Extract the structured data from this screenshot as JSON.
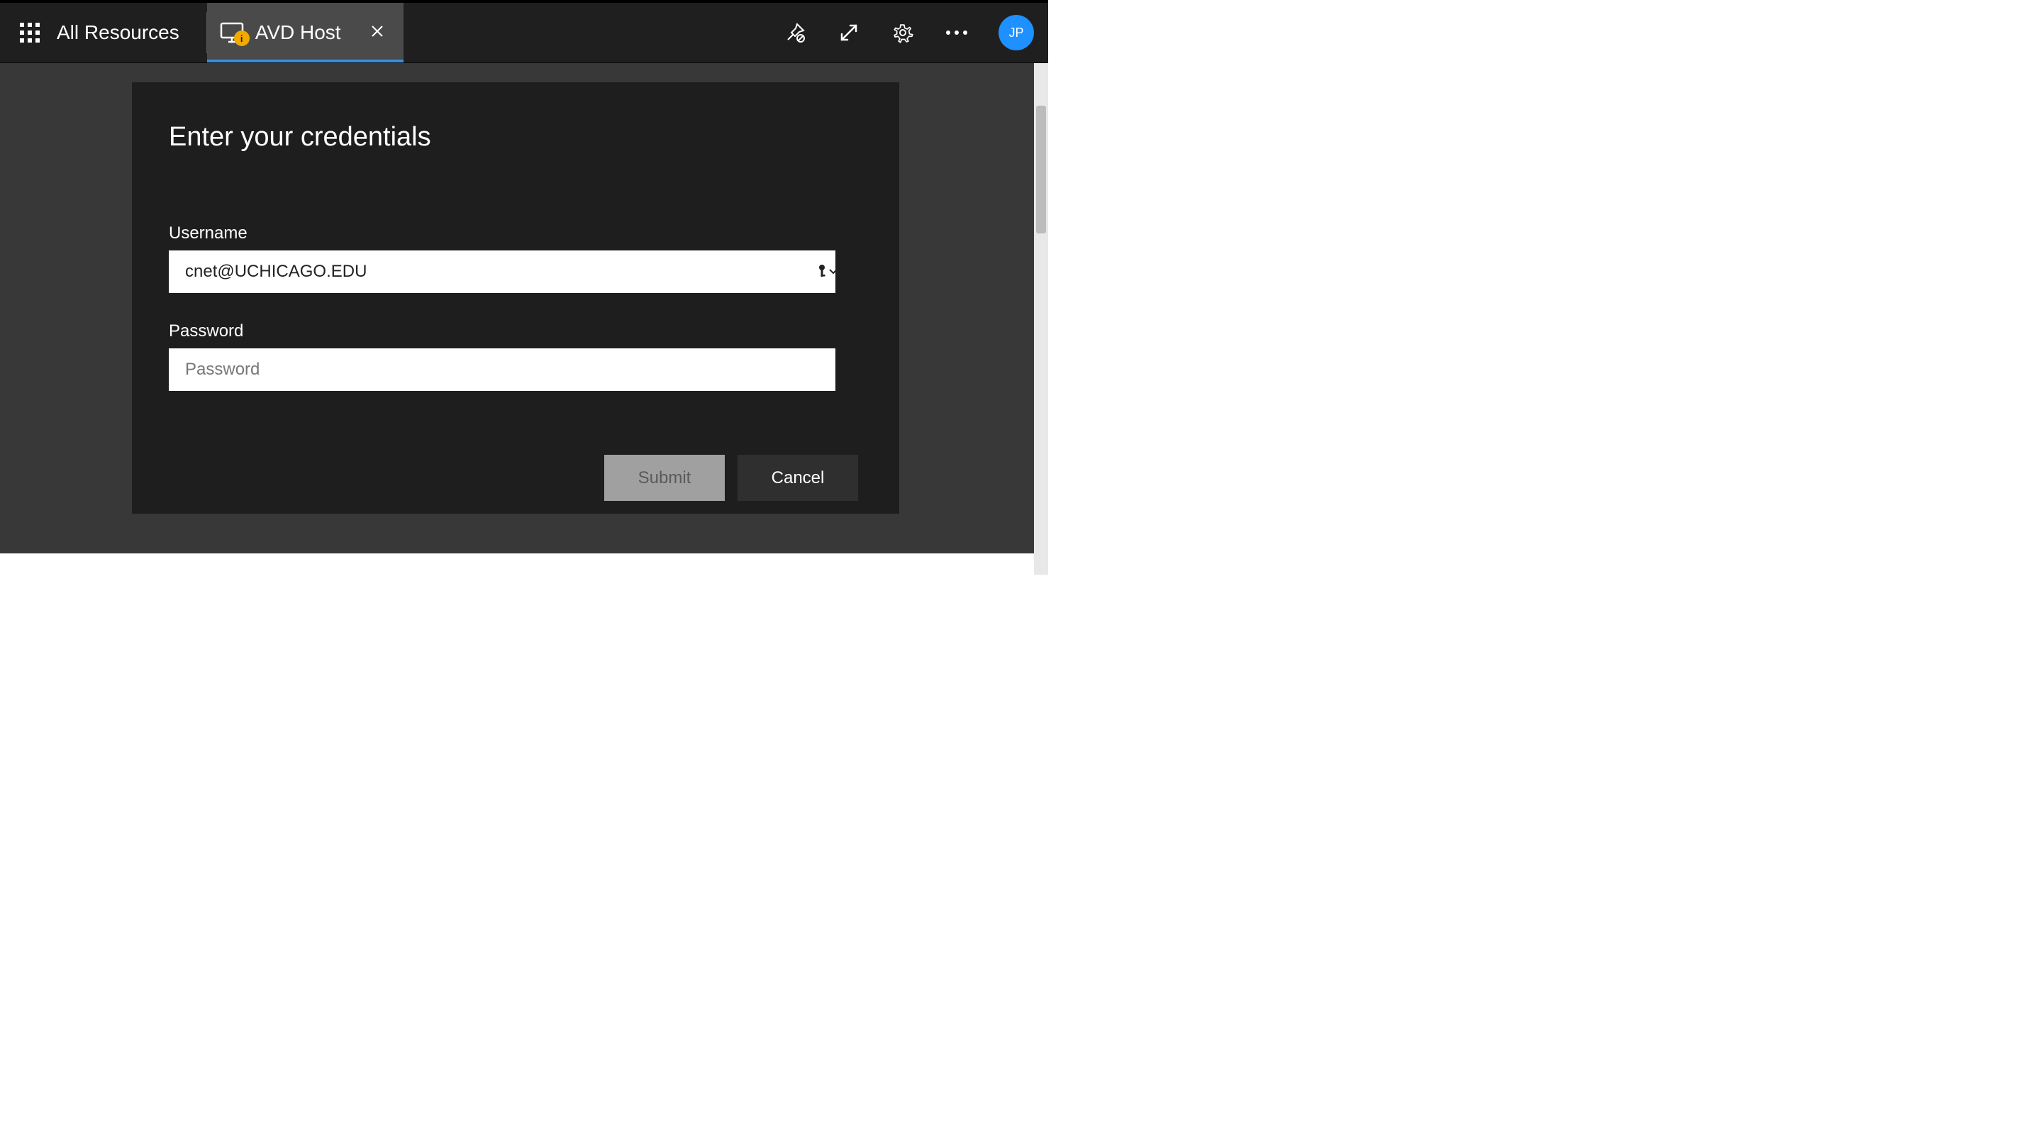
{
  "header": {
    "all_resources_label": "All Resources",
    "tab": {
      "title": "AVD Host",
      "badge_letter": "i"
    },
    "avatar_initials": "JP"
  },
  "modal": {
    "title": "Enter your credentials",
    "username": {
      "label": "Username",
      "value": "cnet@UCHICAGO.EDU"
    },
    "password": {
      "label": "Password",
      "placeholder": "Password",
      "value": ""
    },
    "buttons": {
      "submit": "Submit",
      "cancel": "Cancel"
    }
  }
}
